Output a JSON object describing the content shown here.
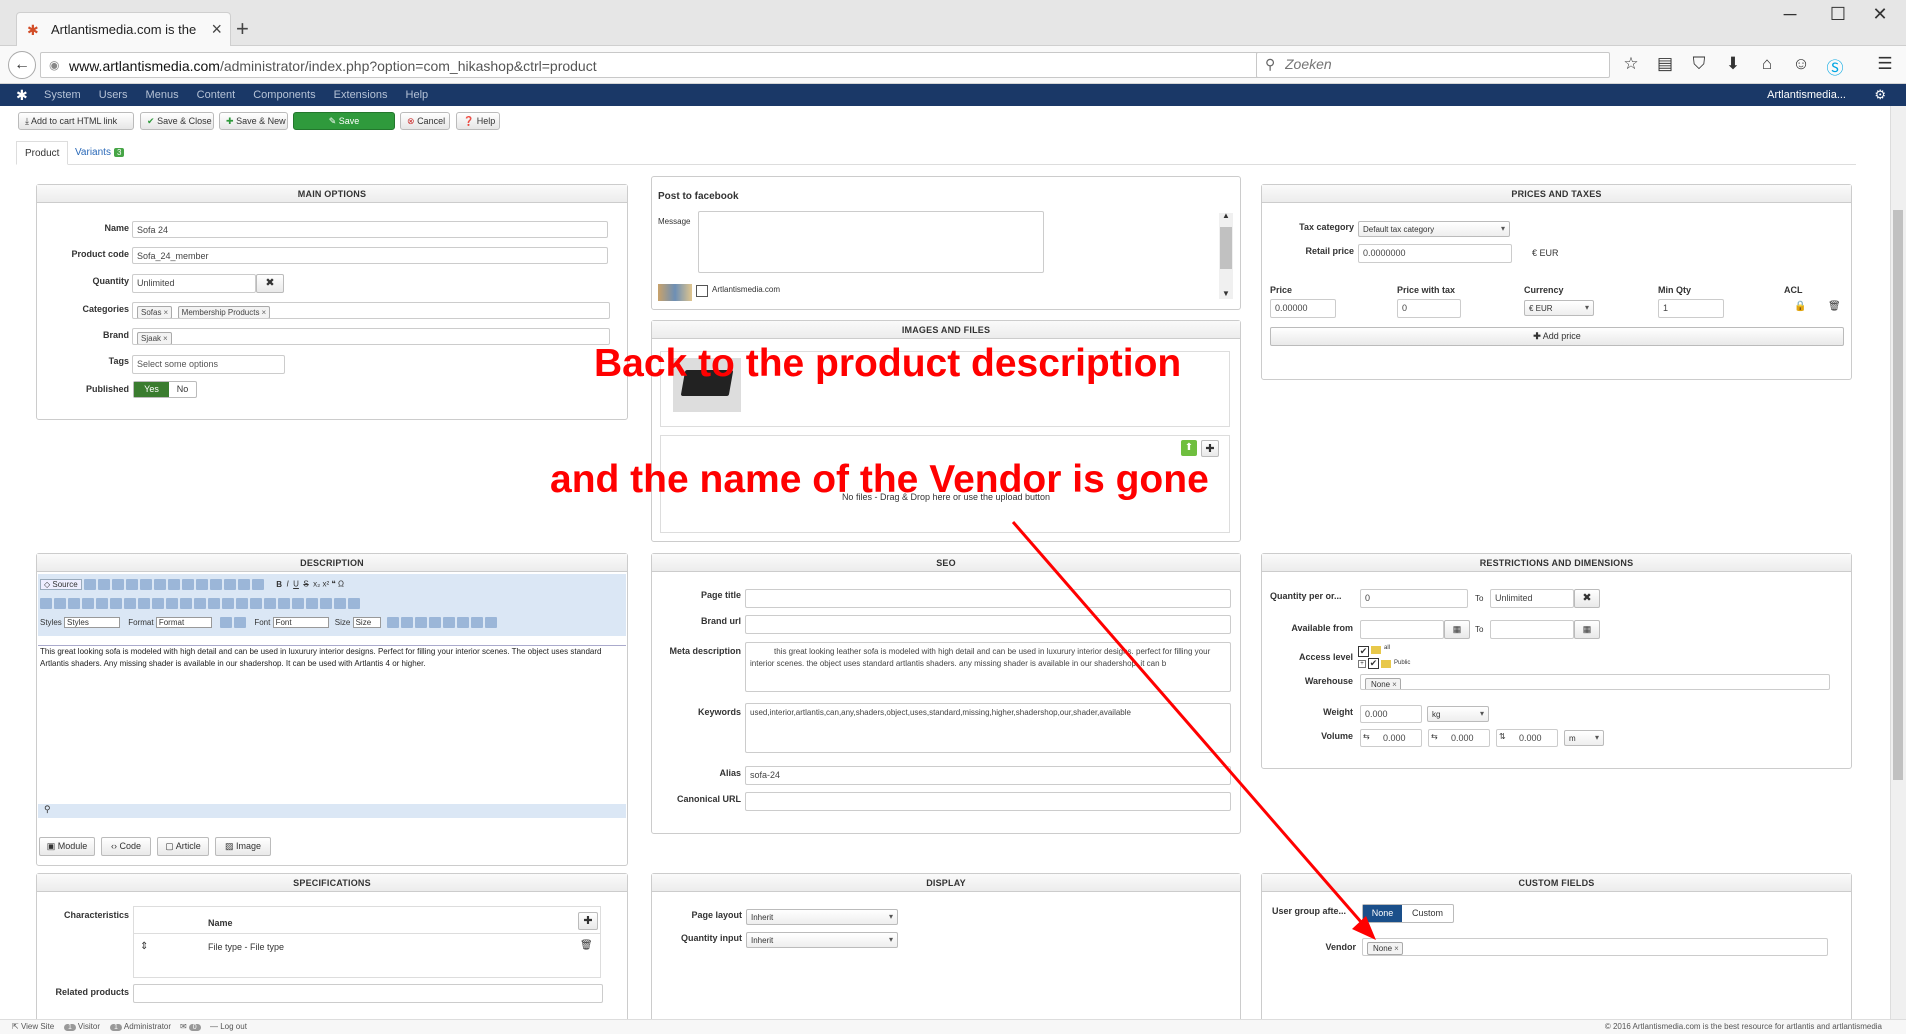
{
  "browser": {
    "tab_title": "Artlantismedia.com is the ...",
    "url_host": "www.artlantismedia.com",
    "url_path": "/administrator/index.php?option=com_hikashop&ctrl=product",
    "search_placeholder": "Zoeken"
  },
  "admin_menu": [
    "System",
    "Users",
    "Menus",
    "Content",
    "Components",
    "Extensions",
    "Help"
  ],
  "admin_site": "Artlantismedia...",
  "toolbar": {
    "add_to_cart": "Add to cart HTML link",
    "save_close": "Save & Close",
    "save_new": "Save & New",
    "save": "Save",
    "cancel": "Cancel",
    "help": "Help"
  },
  "tabs": {
    "product": "Product",
    "variants": "Variants",
    "variants_count": "3"
  },
  "main_options": {
    "title": "MAIN OPTIONS",
    "name_label": "Name",
    "name_value": "Sofa 24",
    "code_label": "Product code",
    "code_value": "Sofa_24_member",
    "qty_label": "Quantity",
    "qty_value": "Unlimited",
    "cat_label": "Categories",
    "categories": [
      "Sofas",
      "Membership Products"
    ],
    "brand_label": "Brand",
    "brand": "Sjaak",
    "tags_label": "Tags",
    "tags_placeholder": "Select some options",
    "published_label": "Published",
    "yes": "Yes",
    "no": "No"
  },
  "facebook": {
    "title": "Post to facebook",
    "message_label": "Message",
    "page_name": "Artlantismedia.com"
  },
  "images": {
    "title": "IMAGES AND FILES",
    "no_files": "No files - Drag & Drop here or use the upload button"
  },
  "prices": {
    "title": "PRICES AND TAXES",
    "tax_label": "Tax category",
    "tax_value": "Default tax category",
    "retail_label": "Retail price",
    "retail_value": "0.0000000",
    "retail_currency": "€ EUR",
    "cols": {
      "price": "Price",
      "price_tax": "Price with tax",
      "currency": "Currency",
      "min_qty": "Min Qty",
      "acl": "ACL"
    },
    "row": {
      "price": "0.00000",
      "price_tax": "0",
      "currency": "€ EUR",
      "min_qty": "1"
    },
    "add_price": "Add price"
  },
  "annotations": {
    "line1": "Back to the product description",
    "line2": "and the name of the Vendor is gone"
  },
  "description": {
    "title": "DESCRIPTION",
    "text": "This great looking sofa is modeled with high detail and can be used in luxurury interior designs. Perfect for filling your interior scenes. The object uses standard Artlantis shaders. Any missing shader is available in our shadershop. It can be used with Artlantis 4 or higher.",
    "source": "Source",
    "styles_label": "Styles",
    "styles_value": "Styles",
    "format_label": "Format",
    "format_value": "Format",
    "font_label": "Font",
    "font_value": "Font",
    "size_label": "Size",
    "size_value": "Size",
    "btn_module": "Module",
    "btn_code": "Code",
    "btn_article": "Article",
    "btn_image": "Image"
  },
  "seo": {
    "title": "SEO",
    "page_title_label": "Page title",
    "brand_url_label": "Brand url",
    "meta_label": "Meta description",
    "meta_value": "this great looking leather sofa is modeled with high detail and can be used in luxurury interior designs. perfect for filling your interior scenes. the object uses standard artlantis shaders. any missing shader is available in our shadershop. it can b",
    "keywords_label": "Keywords",
    "keywords_value": "used,interior,artlantis,can,any,shaders,object,uses,standard,missing,higher,shadershop,our,shader,available",
    "alias_label": "Alias",
    "alias_value": "sofa-24",
    "canonical_label": "Canonical URL"
  },
  "restrictions": {
    "title": "RESTRICTIONS AND DIMENSIONS",
    "qty_order_label": "Quantity per or...",
    "qty_order_from": "0",
    "to": "To",
    "qty_order_to": "Unlimited",
    "available_label": "Available from",
    "access_label": "Access level",
    "access_all": "all",
    "access_public": "Public",
    "warehouse_label": "Warehouse",
    "warehouse_value": "None",
    "weight_label": "Weight",
    "weight_value": "0.000",
    "weight_unit": "kg",
    "volume_label": "Volume",
    "volume_values": [
      "0.000",
      "0.000",
      "0.000"
    ],
    "volume_unit": "m"
  },
  "specifications": {
    "title": "SPECIFICATIONS",
    "char_label": "Characteristics",
    "name_col": "Name",
    "row": "File type - File type",
    "related_label": "Related products"
  },
  "display": {
    "title": "DISPLAY",
    "layout_label": "Page layout",
    "layout_value": "Inherit",
    "qty_input_label": "Quantity input",
    "qty_input_value": "Inherit"
  },
  "custom_fields": {
    "title": "CUSTOM FIELDS",
    "user_group_label": "User group afte...",
    "none": "None",
    "custom": "Custom",
    "vendor_label": "Vendor",
    "vendor_value": "None"
  },
  "statusbar": {
    "view_site": "View Site",
    "visitors_count": "1",
    "visitors": "Visitor",
    "admins_count": "1",
    "admins": "Administrator",
    "messages_count": "0",
    "logout": "Log out",
    "copyright": "© 2016 Artlantismedia.com is the best resource for artlantis and artlantismedia"
  },
  "colors": {
    "annotation": "#ff0000",
    "admin_bar": "#1a3867",
    "save_green": "#2f9a3c"
  }
}
